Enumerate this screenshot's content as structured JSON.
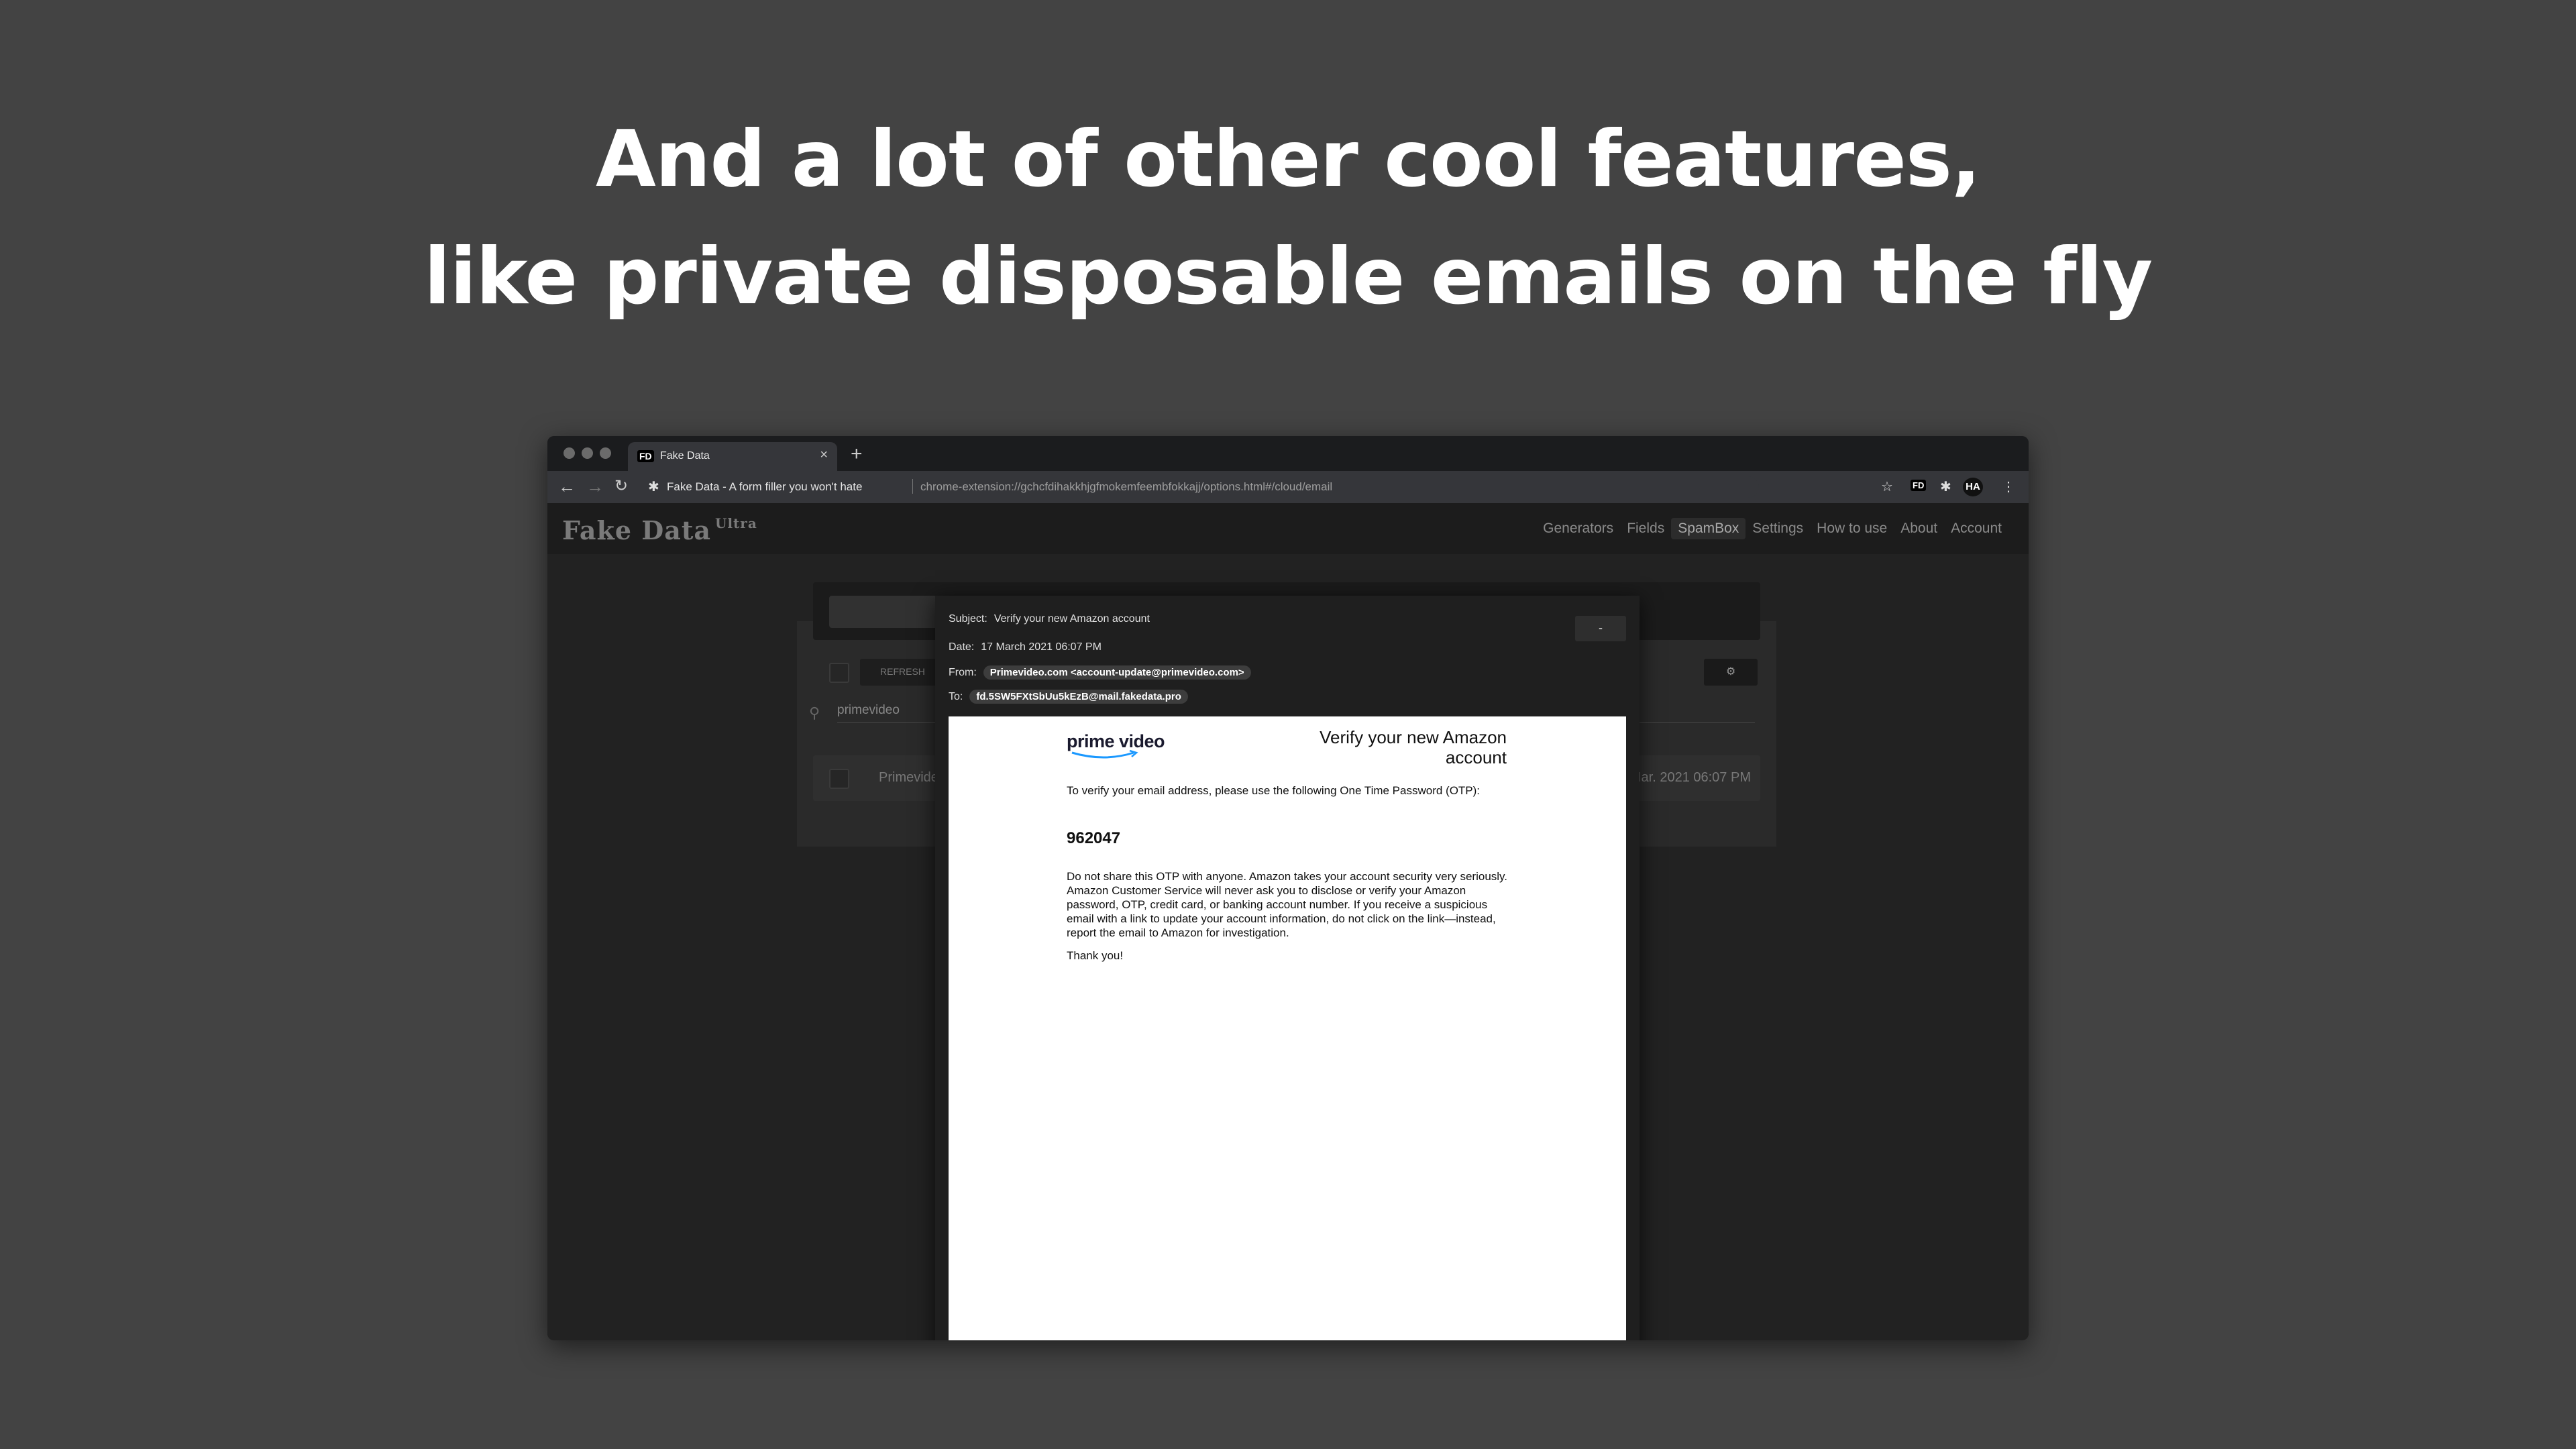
{
  "headline": {
    "line1": "And a lot of other cool features,",
    "line2": "like private disposable emails on the fly"
  },
  "browser": {
    "tab_favicon": "FD",
    "tab_title": "Fake Data",
    "tab_close": "×",
    "new_tab": "+",
    "site_name": "Fake Data - A form filler you won't hate",
    "url": "chrome-extension://gchcfdihakkhjgfmokemfeembfokkajj/options.html#/cloud/email",
    "ext_badge": "FD",
    "profile_initials": "HA"
  },
  "app": {
    "logo": "Fake Data",
    "logo_suffix": "Ultra",
    "nav": [
      "Generators",
      "Fields",
      "SpamBox",
      "Settings",
      "How to use",
      "About",
      "Account"
    ],
    "active_nav": "SpamBox",
    "refresh_label": "REFRESH",
    "search_value": "primevideo",
    "row_sender": "Primevideo",
    "row_date": "17 Mar. 2021 06:07 PM"
  },
  "modal": {
    "subject_label": "Subject:",
    "subject": "Verify your new Amazon account",
    "date_label": "Date:",
    "date": "17 March 2021 06:07 PM",
    "from_label": "From:",
    "from": "Primevideo.com <account-update@primevideo.com>",
    "to_label": "To:",
    "to": "fd.5SW5FXtSbUu5kEzB@mail.fakedata.pro",
    "close_glyph": "-"
  },
  "email": {
    "logo": "prime video",
    "heading": "Verify your new Amazon account",
    "intro": "To verify your email address, please use the following One Time Password (OTP):",
    "otp": "962047",
    "warning": "Do not share this OTP with anyone. Amazon takes your account security very seriously. Amazon Customer Service will never ask you to disclose or verify your Amazon password, OTP, credit card, or banking account number. If you receive a suspicious email with a link to update your account information, do not click on the link—instead, report the email to Amazon for investigation.",
    "signoff": "Thank you!"
  },
  "icons": {
    "back": "back-arrow-icon",
    "forward": "forward-arrow-icon",
    "reload": "reload-icon",
    "star": "star-icon",
    "puzzle": "puzzle-icon",
    "menu": "kebab-menu-icon",
    "search": "search-icon",
    "gear": "gear-icon",
    "chat": "chat-icon"
  }
}
